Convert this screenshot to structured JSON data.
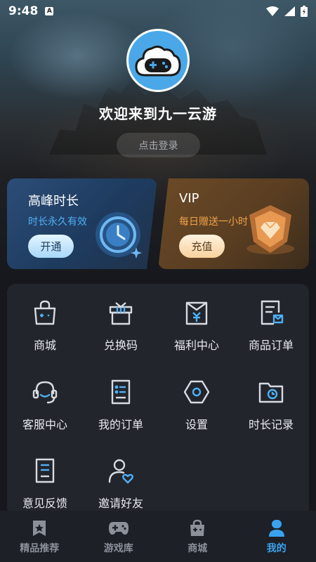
{
  "status_bar": {
    "time": "9:48",
    "notification_badge": "A"
  },
  "header": {
    "welcome_text": "欢迎来到九一云游",
    "login_button": "点击登录"
  },
  "promo_cards": [
    {
      "id": "peak",
      "title": "高峰时长",
      "subtitle": "时长永久有效",
      "button": "开通",
      "accent": "#4fb0f5"
    },
    {
      "id": "vip",
      "title": "VIP",
      "subtitle": "每日赠送一小时",
      "button": "充值",
      "accent": "#f0a24a"
    }
  ],
  "menu": {
    "items": [
      {
        "label": "商城",
        "icon": "shopping-bag-icon"
      },
      {
        "label": "兑换码",
        "icon": "gift-icon"
      },
      {
        "label": "福利中心",
        "icon": "welfare-icon"
      },
      {
        "label": "商品订单",
        "icon": "order-receipt-icon"
      },
      {
        "label": "客服中心",
        "icon": "headset-icon"
      },
      {
        "label": "我的订单",
        "icon": "document-list-icon"
      },
      {
        "label": "设置",
        "icon": "settings-hexagon-icon"
      },
      {
        "label": "时长记录",
        "icon": "time-folder-icon"
      },
      {
        "label": "意见反馈",
        "icon": "feedback-icon"
      },
      {
        "label": "邀请好友",
        "icon": "invite-user-icon"
      }
    ]
  },
  "tabbar": {
    "tabs": [
      {
        "label": "精品推荐",
        "icon": "star-bookmark-icon",
        "active": false
      },
      {
        "label": "游戏库",
        "icon": "gamepad-icon",
        "active": false
      },
      {
        "label": "商城",
        "icon": "shop-bag-icon",
        "active": false
      },
      {
        "label": "我的",
        "icon": "user-icon",
        "active": true
      }
    ]
  },
  "colors": {
    "accent_blue": "#3aa3f0",
    "icon_stroke": "#d8dce2",
    "icon_highlight": "#4fb0f5",
    "background": "#16181d"
  }
}
